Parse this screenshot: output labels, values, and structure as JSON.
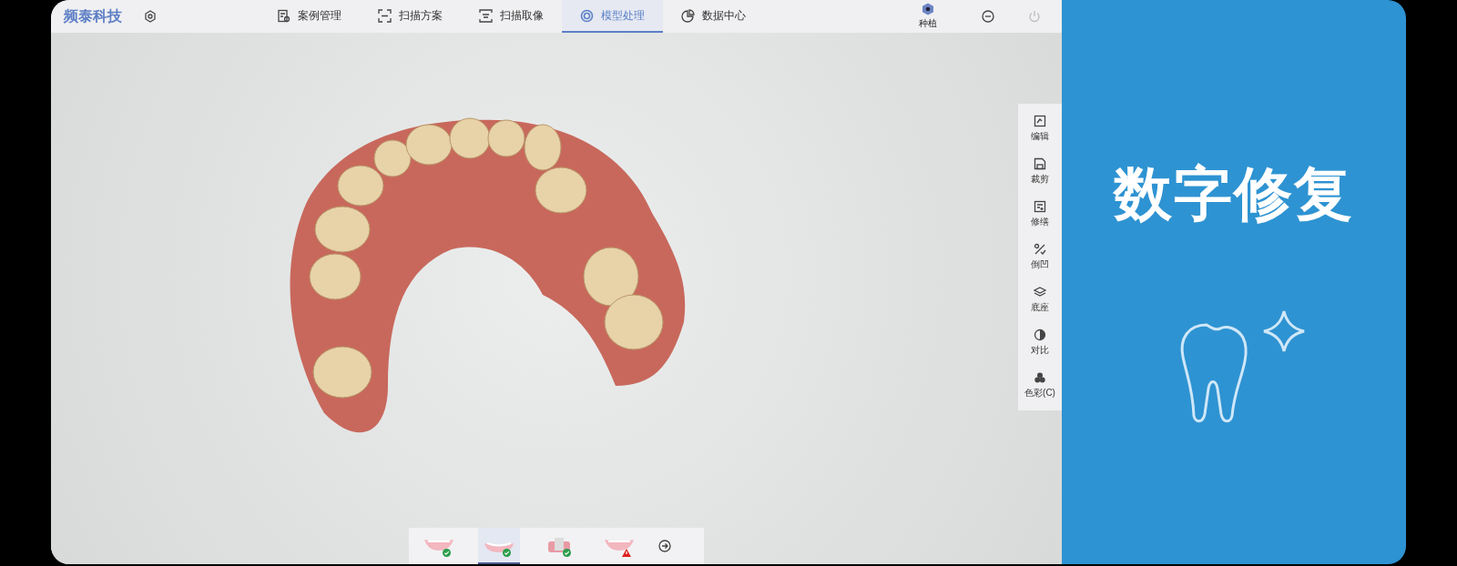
{
  "app": {
    "logo": "频泰科技",
    "tabs": [
      {
        "label": "案例管理",
        "selected": false
      },
      {
        "label": "扫描方案",
        "selected": false
      },
      {
        "label": "扫描取像",
        "selected": false
      },
      {
        "label": "模型处理",
        "selected": true
      },
      {
        "label": "数据中心",
        "selected": false
      }
    ],
    "implant": {
      "label": "种植"
    }
  },
  "tools": [
    {
      "label": "编辑"
    },
    {
      "label": "裁剪"
    },
    {
      "label": "修缮"
    },
    {
      "label": "倒凹"
    },
    {
      "label": "底座"
    },
    {
      "label": "对比"
    },
    {
      "label": "色彩(C)"
    }
  ],
  "steps": [
    {
      "kind": "done",
      "selected": false
    },
    {
      "kind": "done",
      "selected": true
    },
    {
      "kind": "done",
      "selected": false
    },
    {
      "kind": "warning",
      "selected": false
    }
  ],
  "promo": {
    "title": "数字修复"
  }
}
